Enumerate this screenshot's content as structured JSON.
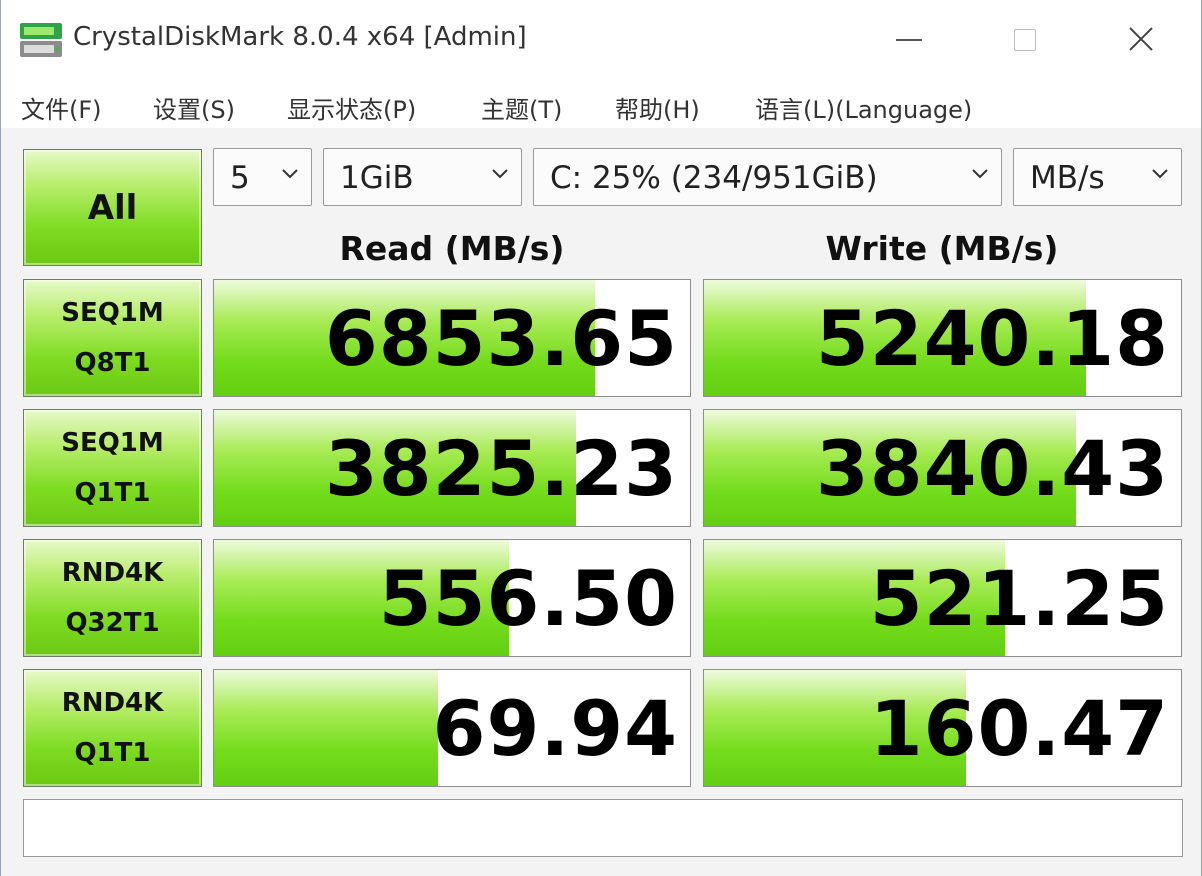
{
  "window": {
    "title": "CrystalDiskMark 8.0.4 x64 [Admin]"
  },
  "menu": [
    "文件(F)",
    "设置(S)",
    "显示状态(P)",
    "主题(T)",
    "帮助(H)",
    "语言(L)(Language)"
  ],
  "controls": {
    "all_label": "All",
    "count": "5",
    "size": "1GiB",
    "drive": "C: 25% (234/951GiB)",
    "unit": "MB/s"
  },
  "headers": {
    "read": "Read (MB/s)",
    "write": "Write (MB/s)"
  },
  "tests": [
    {
      "line1": "SEQ1M",
      "line2": "Q8T1",
      "read": "6853.65",
      "write": "5240.18",
      "read_fill": 0.8,
      "write_fill": 0.8
    },
    {
      "line1": "SEQ1M",
      "line2": "Q1T1",
      "read": "3825.23",
      "write": "3840.43",
      "read_fill": 0.76,
      "write_fill": 0.78
    },
    {
      "line1": "RND4K",
      "line2": "Q32T1",
      "read": "556.50",
      "write": "521.25",
      "read_fill": 0.62,
      "write_fill": 0.63
    },
    {
      "line1": "RND4K",
      "line2": "Q1T1",
      "read": "69.94",
      "write": "160.47",
      "read_fill": 0.47,
      "write_fill": 0.55
    }
  ],
  "comment": "",
  "colors": {
    "accent_green": "#74dc1c",
    "bar_border": "#8d8d8d"
  }
}
